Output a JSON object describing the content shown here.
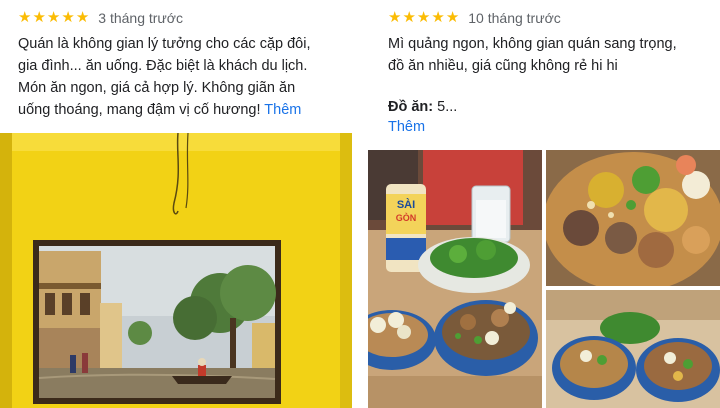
{
  "reviews": [
    {
      "rating": 5,
      "time": "3 tháng trước",
      "text_lines": [
        "Quán là không gian lý tưởng cho các cặp đôi,",
        "gia đình... ăn uống. Đặc biệt là khách du lịch.",
        "Món ăn ngon, giá cả hợp lý. Không giãn ăn",
        "uống thoáng, mang đậm vị cố hương!"
      ],
      "more_label": "Thêm"
    },
    {
      "rating": 5,
      "time": "10 tháng trước",
      "text_lines": [
        "Mì quảng ngon, không gian quán sang trọng,",
        "đồ ăn nhiều, giá cũng không rẻ hi hi"
      ],
      "food_label": "Đồ ăn:",
      "food_value": "5...",
      "more_label": "Thêm"
    }
  ],
  "photos": {
    "left": {
      "can_label_top": "SÀI",
      "can_label_bottom": "GÒN"
    }
  },
  "colors": {
    "star": "#fbbc04",
    "link": "#1a73e8",
    "wall_yellow": "#f2d215"
  },
  "icons": [
    "star-icon"
  ]
}
